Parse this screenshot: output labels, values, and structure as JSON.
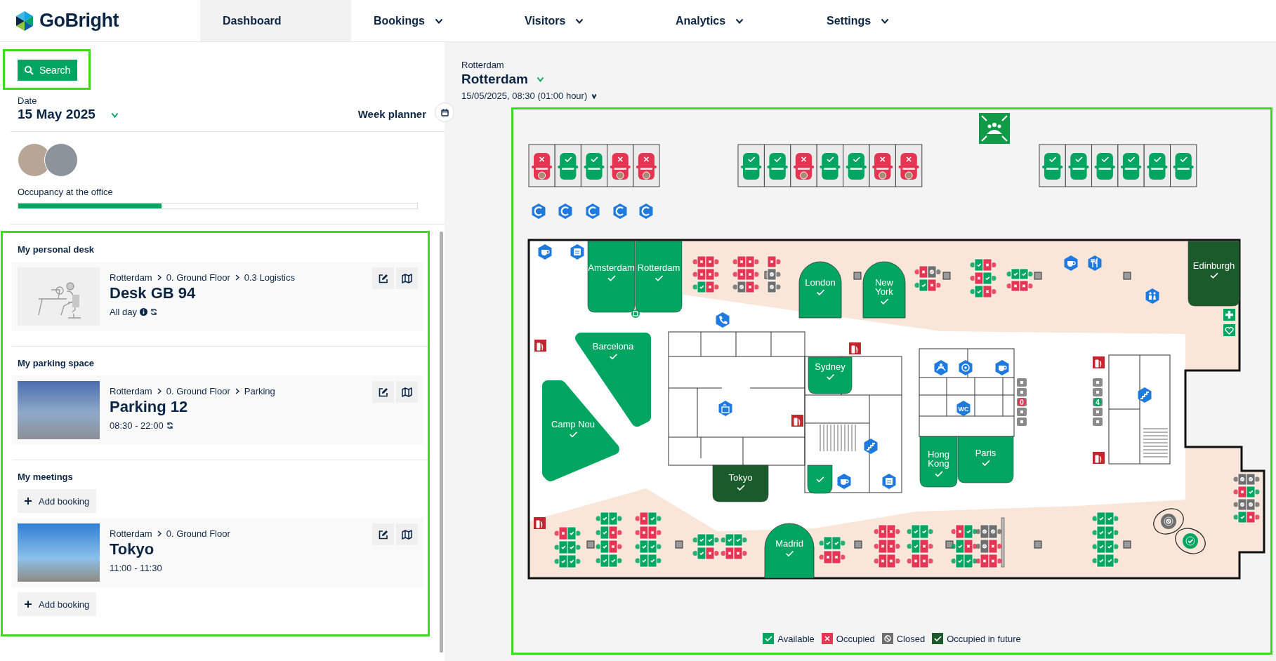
{
  "header": {
    "logo": "GoBright",
    "nav": [
      {
        "label": "Dashboard",
        "selected": true,
        "dropdown": false
      },
      {
        "label": "Bookings",
        "selected": false,
        "dropdown": true
      },
      {
        "label": "Visitors",
        "selected": false,
        "dropdown": true
      },
      {
        "label": "Analytics",
        "selected": false,
        "dropdown": true
      },
      {
        "label": "Settings",
        "selected": false,
        "dropdown": true
      }
    ]
  },
  "sidebar": {
    "search_button": "Search",
    "date": {
      "label": "Date",
      "value": "15 May 2025"
    },
    "week_planner": "Week planner",
    "occupancy": {
      "label": "Occupancy at the office",
      "level": 0.36
    },
    "sections": [
      {
        "title": "My personal desk",
        "items": [
          {
            "kind": "desk",
            "path": [
              "Rotterdam",
              "0. Ground Floor",
              "0.3 Logistics"
            ],
            "title": "Desk GB 94",
            "time": "All day",
            "info": true,
            "recurring": true
          }
        ]
      },
      {
        "title": "My parking space",
        "items": [
          {
            "kind": "parking",
            "path": [
              "Rotterdam",
              "0. Ground Floor",
              "Parking"
            ],
            "title": "Parking 12",
            "time": "08:30 - 22:00",
            "info": false,
            "recurring": true
          }
        ]
      },
      {
        "title": "My meetings",
        "items": [
          {
            "kind": "add",
            "label": "Add booking"
          },
          {
            "kind": "room",
            "path": [
              "Rotterdam",
              "0. Ground Floor"
            ],
            "title": "Tokyo",
            "time": "11:00 - 11:30",
            "info": false,
            "recurring": false
          },
          {
            "kind": "add",
            "label": "Add booking"
          }
        ]
      }
    ]
  },
  "map": {
    "location_label": "Rotterdam",
    "location": "Rotterdam",
    "datetime": "15/05/2025, 08:30 (01:00 hour)",
    "parking_rows": [
      {
        "spots": [
          {
            "occupied": true
          },
          {
            "occupied": false
          },
          {
            "occupied": false
          },
          {
            "occupied": true
          },
          {
            "occupied": true
          }
        ]
      },
      {
        "spots": [
          {
            "occupied": false
          },
          {
            "occupied": false
          },
          {
            "occupied": true
          },
          {
            "occupied": false
          },
          {
            "occupied": false
          },
          {
            "occupied": true
          },
          {
            "occupied": true
          }
        ]
      },
      {
        "spots": [
          {
            "occupied": false
          },
          {
            "occupied": false
          },
          {
            "occupied": false
          },
          {
            "occupied": false
          },
          {
            "occupied": false
          },
          {
            "occupied": false
          }
        ]
      }
    ],
    "rooms": [
      {
        "name": "Amsterdam",
        "future": false
      },
      {
        "name": "Rotterdam",
        "future": false
      },
      {
        "name": "London",
        "future": false
      },
      {
        "name": "New York",
        "future": false
      },
      {
        "name": "Edinburgh",
        "future": true
      },
      {
        "name": "Barcelona",
        "future": false
      },
      {
        "name": "Sydney",
        "future": false
      },
      {
        "name": "Camp Nou",
        "future": false
      },
      {
        "name": "Hong Kong",
        "future": false
      },
      {
        "name": "Paris",
        "future": false
      },
      {
        "name": "Tokyo",
        "future": true
      },
      {
        "future": false
      },
      {
        "name": "Madrid",
        "future": false
      }
    ],
    "desks": [
      {
        "seats": [
          {
            "occupied": true,
            "closed": false
          },
          {
            "occupied": true,
            "closed": false
          },
          {
            "occupied": true,
            "closed": false
          },
          {
            "occupied": true,
            "closed": false
          },
          {
            "occupied": false,
            "closed": false
          },
          {
            "occupied": true,
            "closed": false
          }
        ]
      },
      {
        "seats": [
          {
            "occupied": true,
            "closed": false
          },
          {
            "occupied": true,
            "closed": false
          },
          {
            "occupied": true,
            "closed": false
          },
          {
            "occupied": true,
            "closed": false
          },
          {
            "occupied": false,
            "closed": true
          },
          {
            "occupied": true,
            "closed": false
          }
        ]
      },
      {
        "seats": [
          {
            "occupied": true,
            "closed": false
          },
          {
            "occupied": false,
            "closed": true
          },
          {
            "occupied": false,
            "closed": true
          }
        ]
      },
      {
        "seats": [
          {
            "occupied": true,
            "closed": false
          },
          {
            "occupied": false,
            "closed": true
          },
          {
            "occupied": false,
            "closed": false
          },
          {
            "occupied": true,
            "closed": false
          }
        ]
      },
      {
        "seats": [
          {
            "occupied": false,
            "closed": false
          },
          {
            "occupied": true,
            "closed": false
          },
          {
            "occupied": true,
            "closed": false
          },
          {
            "occupied": false,
            "closed": false
          },
          {
            "occupied": false,
            "closed": false
          },
          {
            "occupied": true,
            "closed": false
          }
        ]
      },
      {
        "seats": [
          {
            "occupied": false,
            "closed": false
          },
          {
            "occupied": false,
            "closed": false
          },
          {
            "occupied": true,
            "closed": false
          },
          {
            "occupied": true,
            "closed": false
          }
        ]
      },
      {
        "seats": [
          {
            "occupied": true,
            "closed": false
          },
          {
            "occupied": false,
            "closed": false
          },
          {
            "occupied": false,
            "closed": false
          },
          {
            "occupied": false,
            "closed": false
          },
          {
            "occupied": false,
            "closed": false
          },
          {
            "occupied": false,
            "closed": false
          }
        ]
      },
      {
        "seats": [
          {
            "occupied": false,
            "closed": false
          },
          {
            "occupied": false,
            "closed": false
          },
          {
            "occupied": false,
            "closed": false
          },
          {
            "occupied": true,
            "closed": false
          },
          {
            "occupied": false,
            "closed": false
          },
          {
            "occupied": true,
            "closed": false
          },
          {
            "occupied": false,
            "closed": false
          },
          {
            "occupied": false,
            "closed": false
          }
        ]
      },
      {
        "seats": [
          {
            "occupied": true,
            "closed": false
          },
          {
            "occupied": false,
            "closed": false
          },
          {
            "occupied": true,
            "closed": false
          },
          {
            "occupied": true,
            "closed": false
          },
          {
            "occupied": false,
            "closed": false
          },
          {
            "occupied": false,
            "closed": false
          },
          {
            "occupied": false,
            "closed": false
          },
          {
            "occupied": false,
            "closed": false
          }
        ]
      },
      {
        "seats": [
          {
            "occupied": false,
            "closed": false
          },
          {
            "occupied": false,
            "closed": false
          },
          {
            "occupied": false,
            "closed": false
          },
          {
            "occupied": true,
            "closed": false
          }
        ]
      },
      {
        "seats": [
          {
            "occupied": false,
            "closed": false
          },
          {
            "occupied": false,
            "closed": false
          },
          {
            "occupied": true,
            "closed": false
          },
          {
            "occupied": true,
            "closed": false
          }
        ]
      },
      {
        "seats": [
          {
            "occupied": false,
            "closed": false
          },
          {
            "occupied": false,
            "closed": false
          },
          {
            "occupied": true,
            "closed": false
          },
          {
            "occupied": true,
            "closed": false
          }
        ]
      },
      {
        "seats": [
          {
            "occupied": true,
            "closed": false
          },
          {
            "occupied": true,
            "closed": false
          },
          {
            "occupied": true,
            "closed": false
          },
          {
            "occupied": true,
            "closed": false
          },
          {
            "occupied": true,
            "closed": false
          },
          {
            "occupied": true,
            "closed": false
          }
        ]
      },
      {
        "seats": [
          {
            "occupied": false,
            "closed": false
          },
          {
            "occupied": false,
            "closed": false
          },
          {
            "occupied": false,
            "closed": false
          },
          {
            "occupied": true,
            "closed": false
          },
          {
            "occupied": true,
            "closed": false
          },
          {
            "occupied": true,
            "closed": false
          }
        ]
      },
      {
        "seats": [
          {
            "occupied": true,
            "closed": false
          },
          {
            "occupied": false,
            "closed": false
          },
          {
            "occupied": false,
            "closed": false
          },
          {
            "occupied": true,
            "closed": false
          },
          {
            "occupied": false,
            "closed": false
          },
          {
            "occupied": false,
            "closed": false
          }
        ]
      },
      {
        "seats": [
          {
            "occupied": false,
            "closed": true
          },
          {
            "occupied": false,
            "closed": true
          },
          {
            "occupied": false,
            "closed": true
          },
          {
            "occupied": true,
            "closed": false
          },
          {
            "occupied": true,
            "closed": false
          },
          {
            "occupied": true,
            "closed": false
          }
        ]
      },
      {
        "seats": [
          {
            "occupied": false,
            "closed": false
          },
          {
            "occupied": false,
            "closed": false
          },
          {
            "occupied": false,
            "closed": false
          },
          {
            "occupied": false,
            "closed": false
          },
          {
            "occupied": false,
            "closed": false
          },
          {
            "occupied": false,
            "closed": false
          },
          {
            "occupied": false,
            "closed": false
          },
          {
            "occupied": false,
            "closed": false
          }
        ]
      },
      {
        "seats": [
          {
            "occupied": false,
            "closed": true
          },
          {
            "occupied": false,
            "closed": true
          },
          {
            "occupied": true,
            "closed": false
          },
          {
            "occupied": false,
            "closed": false
          },
          {
            "occupied": false,
            "closed": true
          },
          {
            "occupied": false,
            "closed": true
          },
          {
            "occupied": false,
            "closed": false
          },
          {
            "occupied": true,
            "closed": false
          }
        ]
      }
    ],
    "round_desks": [
      {
        "closed": true
      },
      {
        "closed": false
      }
    ],
    "locker_banks": [
      {
        "count": "0",
        "full": true
      },
      {
        "count": "4",
        "full": false
      }
    ],
    "wc_label": "WC",
    "legend": [
      {
        "label": "Available",
        "kind": "available"
      },
      {
        "label": "Occupied",
        "kind": "occupied"
      },
      {
        "label": "Closed",
        "kind": "closed"
      },
      {
        "label": "Occupied in future",
        "kind": "future"
      }
    ]
  }
}
